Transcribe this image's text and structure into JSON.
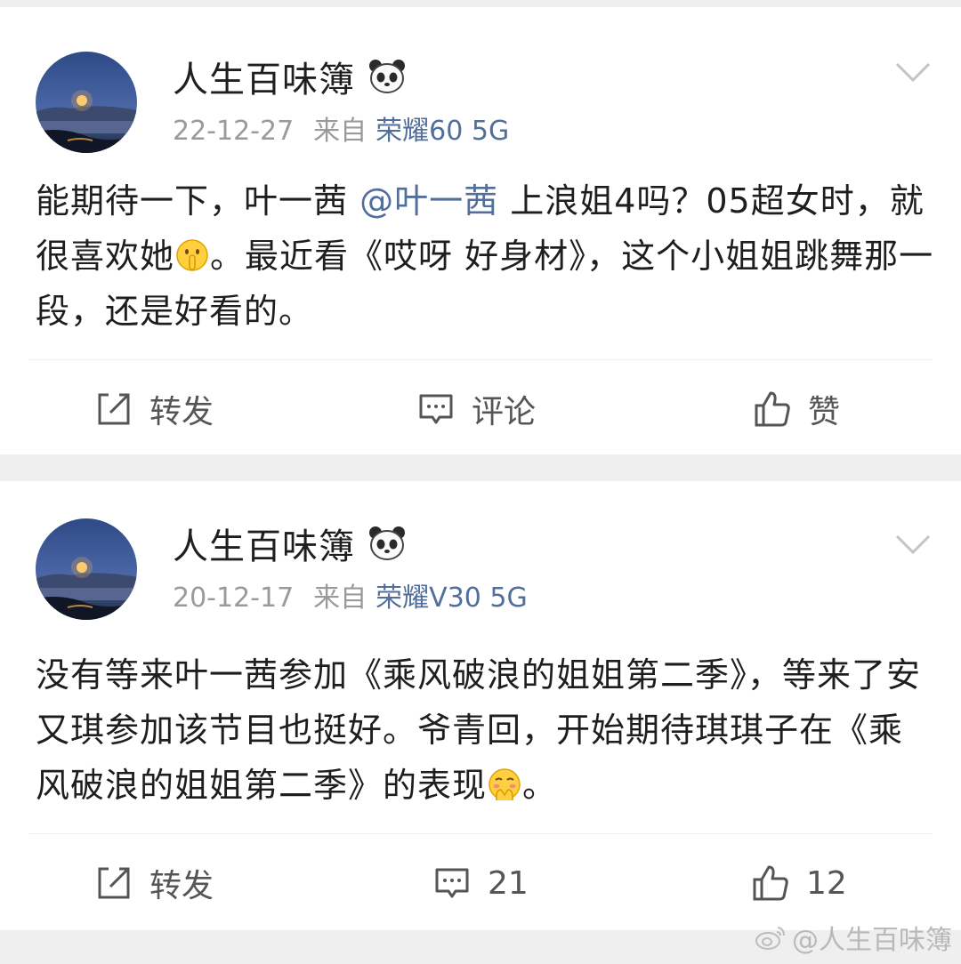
{
  "posts": [
    {
      "author": "人生百味簿",
      "date": "22-12-27",
      "source_prefix": "来自",
      "device": "荣耀60 5G",
      "content_part1": "能期待一下，叶一茜 ",
      "mention": "@叶一茜",
      "content_part2": " 上浪姐4吗？05超女时，就很喜欢她",
      "content_part3": "。最近看《哎呀 好身材》，这个小姐姐跳舞那一段，还是好看的。",
      "emoji": "shushing-face",
      "actions": {
        "repost": "转发",
        "comment": "评论",
        "like": "赞"
      }
    },
    {
      "author": "人生百味簿",
      "date": "20-12-17",
      "source_prefix": "来自",
      "device": "荣耀V30 5G",
      "content_part1": "没有等来叶一茜参加《乘风破浪的姐姐第二季》，等来了安又琪参加该节目也挺好。爷青回，开始期待琪琪子在《乘风破浪的姐姐第二季》的表现",
      "content_part2": "。",
      "emoji": "blushing-hands-face",
      "actions": {
        "repost": "转发",
        "comment": "21",
        "like": "12"
      }
    }
  ],
  "watermark": "@人生百味簿",
  "icons": {
    "avatar": "moonrise-lake-photo",
    "badge": "panda-icon",
    "menu": "chevron-down-icon",
    "repost": "repost-icon",
    "comment": "comment-icon",
    "like": "thumbs-up-icon",
    "watermark": "weibo-logo-icon"
  },
  "colors": {
    "link": "#526f9c",
    "meta": "#9a9a9a",
    "action": "#555555",
    "separator": "#efefef"
  }
}
